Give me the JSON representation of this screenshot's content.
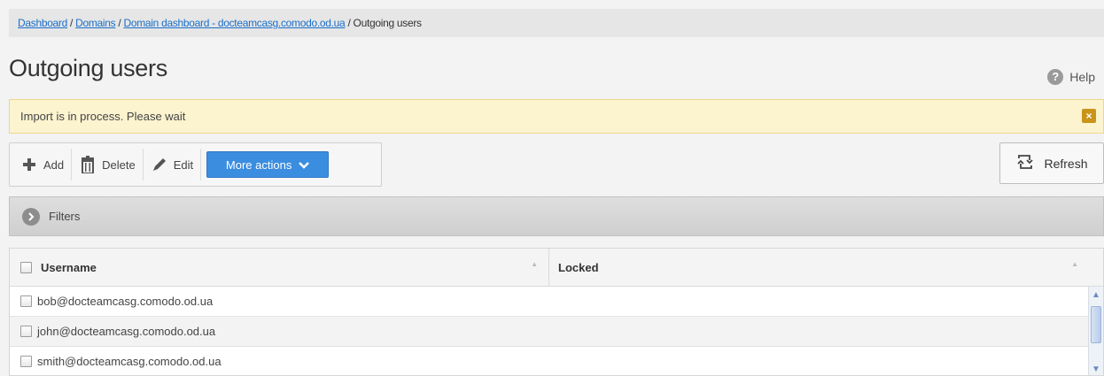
{
  "breadcrumb": {
    "items": [
      "Dashboard",
      "Domains",
      "Domain dashboard - docteamcasg.comodo.od.ua"
    ],
    "separator": " / ",
    "current": "Outgoing users"
  },
  "page": {
    "title": "Outgoing users"
  },
  "help": {
    "label": "Help",
    "icon": "question-circle-icon"
  },
  "alert": {
    "message": "Import is in process. Please wait",
    "close_icon": "close-icon",
    "color": "#fcf3cf"
  },
  "toolbar": {
    "add_label": "Add",
    "delete_label": "Delete",
    "edit_label": "Edit",
    "more_label": "More actions",
    "more_color": "#3b8de0"
  },
  "refresh": {
    "label": "Refresh"
  },
  "filters": {
    "label": "Filters"
  },
  "grid": {
    "columns": [
      "Username",
      "Locked"
    ],
    "rows": [
      {
        "username": "bob@docteamcasg.comodo.od.ua",
        "locked": ""
      },
      {
        "username": "john@docteamcasg.comodo.od.ua",
        "locked": ""
      },
      {
        "username": "smith@docteamcasg.comodo.od.ua",
        "locked": ""
      }
    ]
  }
}
